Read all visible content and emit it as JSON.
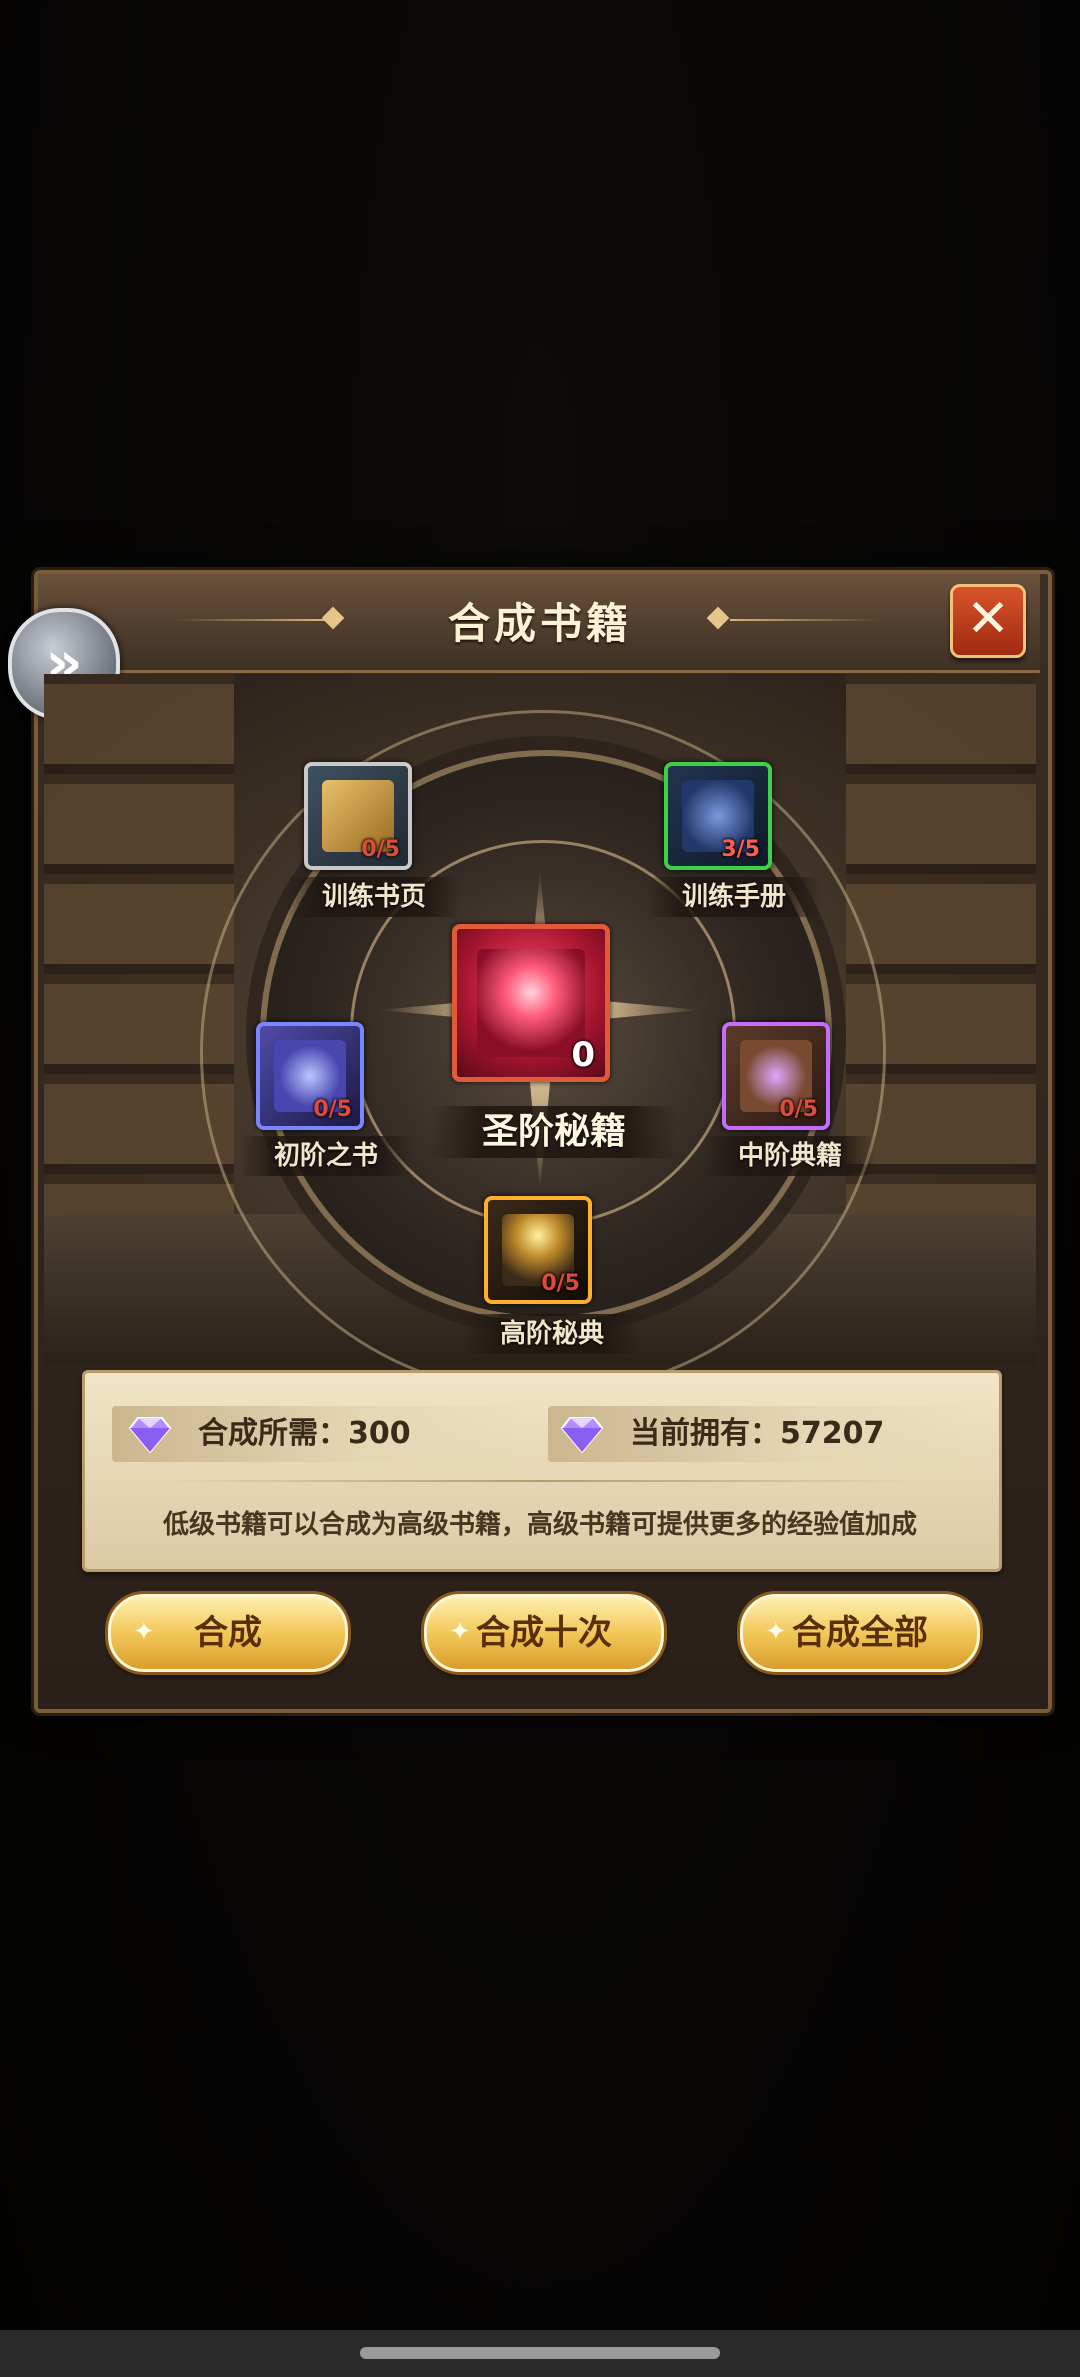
{
  "dialog": {
    "title": "合成书籍",
    "close_icon": "close-icon",
    "side_nav_icon": "double-chevron-right-icon"
  },
  "items": {
    "center": {
      "name": "圣阶秘籍",
      "count": "0"
    },
    "training_page": {
      "name": "训练书页",
      "count": "0/5"
    },
    "training_manual": {
      "name": "训练手册",
      "count": "3/5"
    },
    "beginner_book": {
      "name": "初阶之书",
      "count": "0/5"
    },
    "intermediate_codex": {
      "name": "中阶典籍",
      "count": "0/5"
    },
    "advanced_tome": {
      "name": "高阶秘典",
      "count": "0/5"
    }
  },
  "cost": {
    "required_label": "合成所需：300",
    "owned_label": "当前拥有：57207",
    "gem_icon": "diamond-gem-icon"
  },
  "description": "低级书籍可以合成为高级书籍，高级书籍可提供更多的经验值加成",
  "buttons": {
    "compose": "合成",
    "compose_ten": "合成十次",
    "compose_all": "合成全部"
  },
  "colors": {
    "button_gold": "#f2c85a",
    "close_red": "#c0401e",
    "count_red": "#e04a3a"
  }
}
